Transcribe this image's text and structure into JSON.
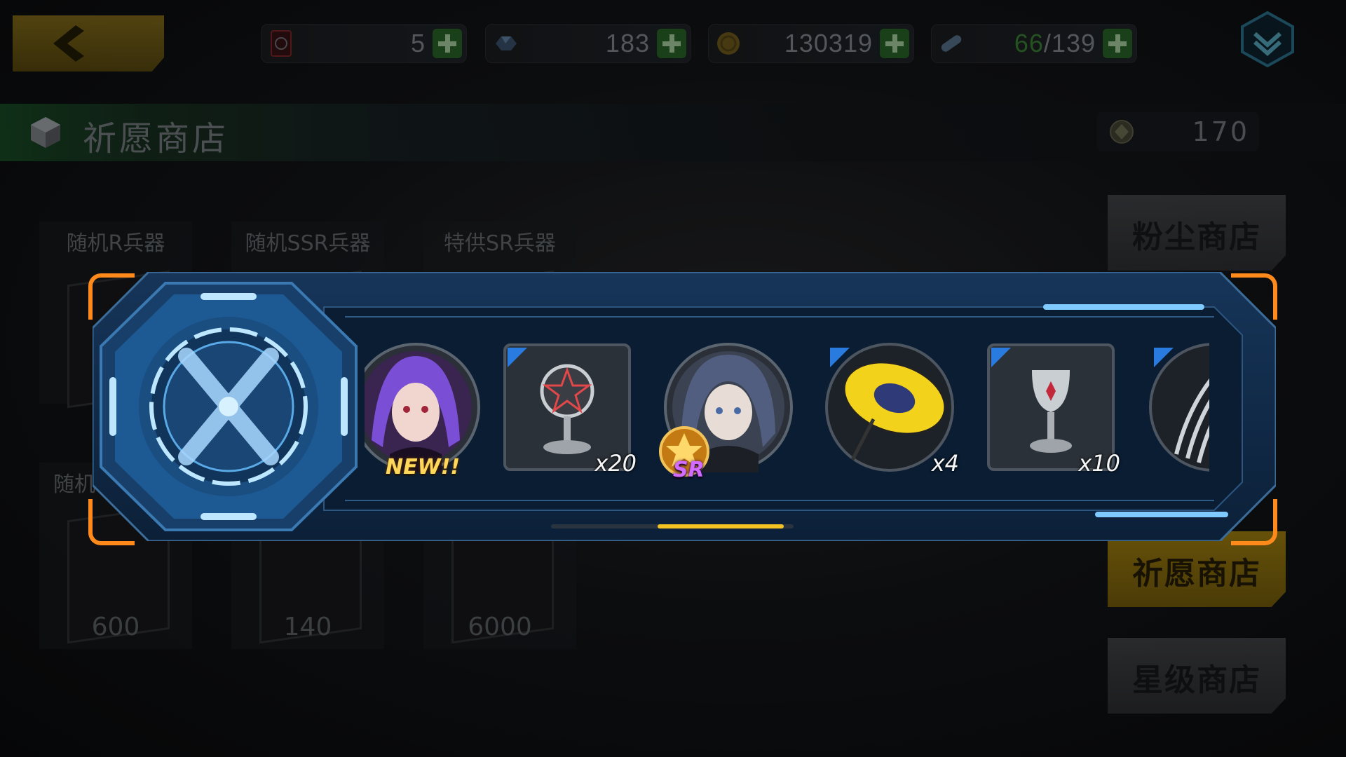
{
  "top_bar": {
    "resources": [
      {
        "name": "ticket",
        "value": "5"
      },
      {
        "name": "crystal",
        "value": "183"
      },
      {
        "name": "gold",
        "value": "130319"
      },
      {
        "name": "stamina",
        "value_current": "66",
        "value_max": "/139"
      }
    ]
  },
  "shop": {
    "title": "祈愿商店",
    "currency_value": "170",
    "items": [
      {
        "name": "随机R兵器",
        "price": ""
      },
      {
        "name": "随机SSR兵器",
        "price": ""
      },
      {
        "name": "特供SR兵器",
        "price": ""
      },
      {
        "name": "随机S",
        "price": "600"
      },
      {
        "name": "",
        "price": "140"
      },
      {
        "name": "",
        "price": "6000"
      }
    ],
    "tabs": [
      "粉尘商店",
      "祈愿商店",
      "星级商店"
    ],
    "active_tab": "祈愿商店"
  },
  "reward_popup": {
    "rewards": [
      {
        "id": "character-purple",
        "label": "NEW!!"
      },
      {
        "id": "pentagram-stand",
        "qty": "x20"
      },
      {
        "id": "character-blue",
        "rank": "SR"
      },
      {
        "id": "yellow-umbrella",
        "qty": "x4"
      },
      {
        "id": "silver-chalice",
        "qty": "x10"
      },
      {
        "id": "weapon-claws"
      }
    ],
    "page_progress": 0.52
  },
  "colors": {
    "accent_orange": "#ff8a1c",
    "panel_blue": "#0f2a47",
    "glow_blue": "#6fc2ff",
    "tab_active": "#c39a12",
    "green_plus": "#2d6f2c"
  }
}
